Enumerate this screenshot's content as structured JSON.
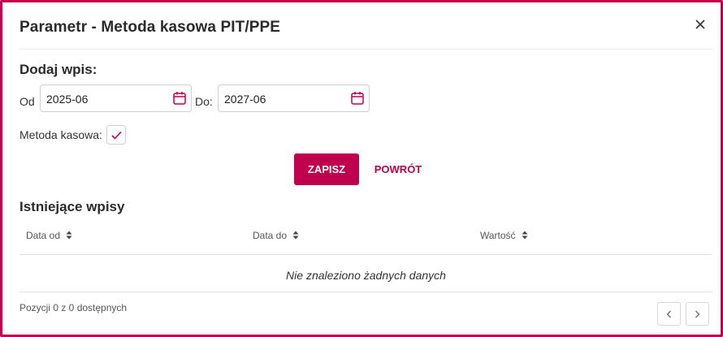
{
  "dialog": {
    "title": "Parametr - Metoda kasowa PIT/PPE",
    "close_icon": "close-icon"
  },
  "form": {
    "section_title": "Dodaj wpis:",
    "from_label": "Od",
    "from_value": "2025-06",
    "to_label": "Do:",
    "to_value": "2027-06",
    "calendar_icon": "calendar-icon",
    "cash_method_label": "Metoda kasowa:",
    "cash_method_checked": true,
    "save_label": "ZAPISZ",
    "back_label": "POWRÓT"
  },
  "existing": {
    "section_title": "Istniejące wpisy",
    "columns": [
      {
        "label": "Data od",
        "sort_icon": "sort-icon"
      },
      {
        "label": "Data do",
        "sort_icon": "sort-icon"
      },
      {
        "label": "Wartość",
        "sort_icon": "sort-icon"
      }
    ],
    "empty_message": "Nie znaleziono żadnych danych",
    "footer_info": "Pozycji 0 z 0 dostępnych",
    "prev_icon": "chevron-left-icon",
    "next_icon": "chevron-right-icon"
  },
  "colors": {
    "accent": "#c0004d",
    "border": "#cfcfcf"
  }
}
